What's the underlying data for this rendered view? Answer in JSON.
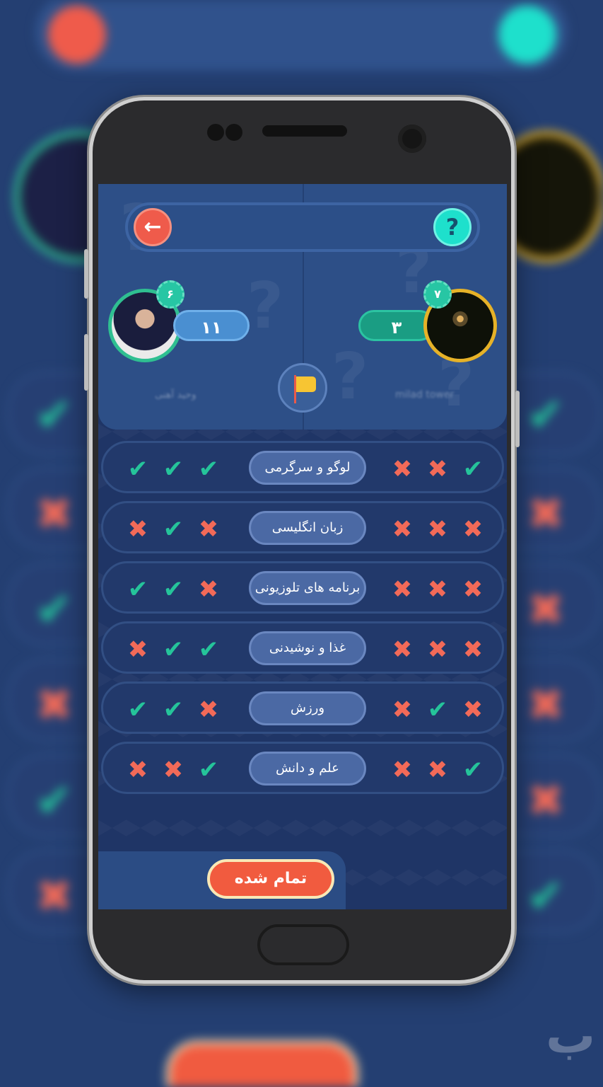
{
  "header": {
    "back_icon": "arrow-left-icon",
    "help_icon": "question-mark-icon",
    "help_glyph": "?",
    "back_glyph": "🡐"
  },
  "players": {
    "left": {
      "score": "۱۱",
      "level": "۶",
      "name": "وحید آهنی"
    },
    "right": {
      "score": "۳",
      "level": "۷",
      "name": "milad tower"
    }
  },
  "flag_icon": "flag-icon",
  "rounds": [
    {
      "category": "لوگو و سرگرمی",
      "left": [
        "ok",
        "ok",
        "ok"
      ],
      "right": [
        "no",
        "no",
        "ok"
      ]
    },
    {
      "category": "زبان انگلیسی",
      "left": [
        "no",
        "ok",
        "no"
      ],
      "right": [
        "no",
        "no",
        "no"
      ]
    },
    {
      "category": "برنامه های تلوزیونی",
      "left": [
        "ok",
        "ok",
        "no"
      ],
      "right": [
        "no",
        "no",
        "no"
      ]
    },
    {
      "category": "غذا و نوشیدنی",
      "left": [
        "no",
        "ok",
        "ok"
      ],
      "right": [
        "no",
        "no",
        "no"
      ]
    },
    {
      "category": "ورزش",
      "left": [
        "ok",
        "ok",
        "no"
      ],
      "right": [
        "no",
        "ok",
        "no"
      ]
    },
    {
      "category": "علم و دانش",
      "left": [
        "no",
        "no",
        "ok"
      ],
      "right": [
        "no",
        "no",
        "ok"
      ]
    }
  ],
  "glyphs": {
    "ok": "✔",
    "no": "✖"
  },
  "done_button": {
    "label": "تمام شده"
  },
  "colors": {
    "correct": "#25c49a",
    "wrong": "#f26a58",
    "accent": "#f15b3f",
    "help": "#1ee0cc"
  }
}
